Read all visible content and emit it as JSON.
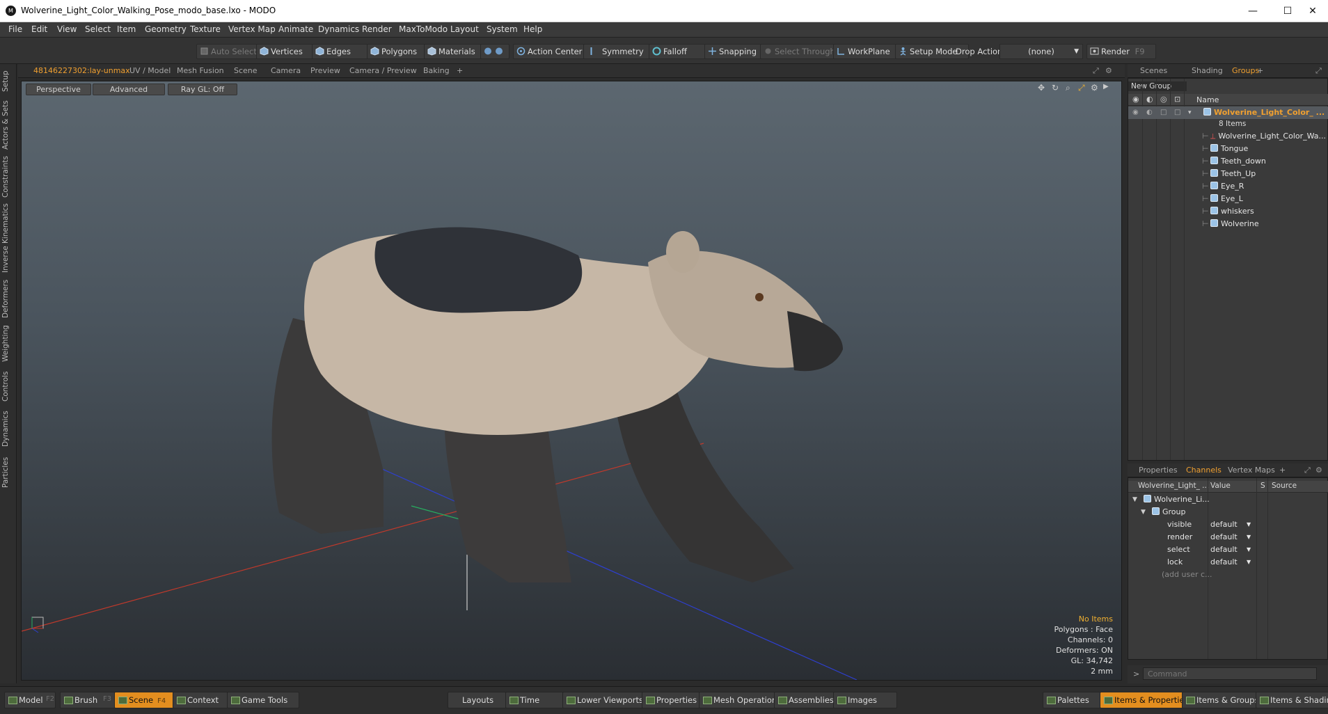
{
  "window": {
    "title": "Wolverine_Light_Color_Walking_Pose_modo_base.lxo - MODO",
    "minimize": "—",
    "maximize": "☐",
    "close": "✕"
  },
  "menu": [
    "File",
    "Edit",
    "View",
    "Select",
    "Item",
    "Geometry",
    "Texture",
    "Vertex Map",
    "Animate",
    "Dynamics",
    "Render",
    "MaxToModo",
    "Layout",
    "System",
    "Help"
  ],
  "toolbar": {
    "auto_select": "Auto Select",
    "vertices": "Vertices",
    "edges": "Edges",
    "polygons": "Polygons",
    "materials": "Materials",
    "action_center": "Action Center",
    "symmetry": "Symmetry",
    "falloff": "Falloff",
    "snapping": "Snapping",
    "select_through": "Select Through",
    "workplane": "WorkPlane",
    "setup_mode": "Setup Mode",
    "drop_action_label": "Drop Action",
    "drop_action_value": "(none)",
    "render": "Render",
    "render_key": "F9"
  },
  "left_tabs": [
    "Setup",
    "Actors & Sets",
    "Constraints",
    "Inverse Kinematics",
    "Deformers",
    "Weighting",
    "Controls",
    "Dynamics",
    "Particles"
  ],
  "viewport_tabs": {
    "active": "48146227302:lay-unmax",
    "others": [
      "UV / Model",
      "Mesh Fusion",
      "Scene",
      "Camera",
      "Preview",
      "Camera / Preview",
      "Baking"
    ],
    "add": "+"
  },
  "viewport": {
    "view_mode": "Perspective",
    "shading": "Advanced",
    "raygl": "Ray GL: Off",
    "hud": {
      "no_items": "No Items",
      "polygons": "Polygons : Face",
      "channels": "Channels: 0",
      "deformers": "Deformers: ON",
      "gl": "GL: 34,742",
      "scale": "2 mm"
    }
  },
  "right_top_tabs": {
    "scenes": "Scenes",
    "shading": "Shading",
    "groups": "Groups",
    "add": "+"
  },
  "groups_panel": {
    "new_group": "New Group",
    "name_header": "Name",
    "root_label": "Wolverine_Light_Color_ ...",
    "root_count": "8 Items",
    "items": [
      "Wolverine_Light_Color_Wa...",
      "Tongue",
      "Teeth_down",
      "Teeth_Up",
      "Eye_R",
      "Eye_L",
      "whiskers",
      "Wolverine"
    ]
  },
  "right_mid_tabs": {
    "properties": "Properties",
    "channels": "Channels",
    "vertex_maps": "Vertex Maps",
    "add": "+"
  },
  "channels_panel": {
    "headers": {
      "name": "Wolverine_Light_ ...",
      "value": "Value",
      "s": "S",
      "source": "Source"
    },
    "item": "Wolverine_Li...",
    "group": "Group",
    "rows": [
      {
        "name": "visible",
        "value": "default"
      },
      {
        "name": "render",
        "value": "default"
      },
      {
        "name": "select",
        "value": "default"
      },
      {
        "name": "lock",
        "value": "default"
      }
    ],
    "add_user": "(add user c..."
  },
  "command": {
    "prompt": ">",
    "placeholder": "Command"
  },
  "bottom_bar": {
    "model": "Model",
    "model_key": "F2",
    "brush": "Brush",
    "brush_key": "F3",
    "scene": "Scene",
    "scene_key": "F4",
    "context": "Context",
    "game_tools": "Game Tools",
    "layouts": "Layouts",
    "time": "Time",
    "lower_viewports": "Lower Viewports",
    "properties": "Properties",
    "mesh_operations": "Mesh Operations",
    "assemblies": "Assemblies",
    "images": "Images",
    "palettes": "Palettes",
    "items_properties": "Items & Properties",
    "items_groups": "Items & Groups",
    "items_shading": "Items & Shading"
  },
  "colors": {
    "accent": "#e38e1f",
    "axis_x": "#c0392b",
    "axis_y": "#27ae60",
    "axis_z": "#2e3fd0"
  }
}
